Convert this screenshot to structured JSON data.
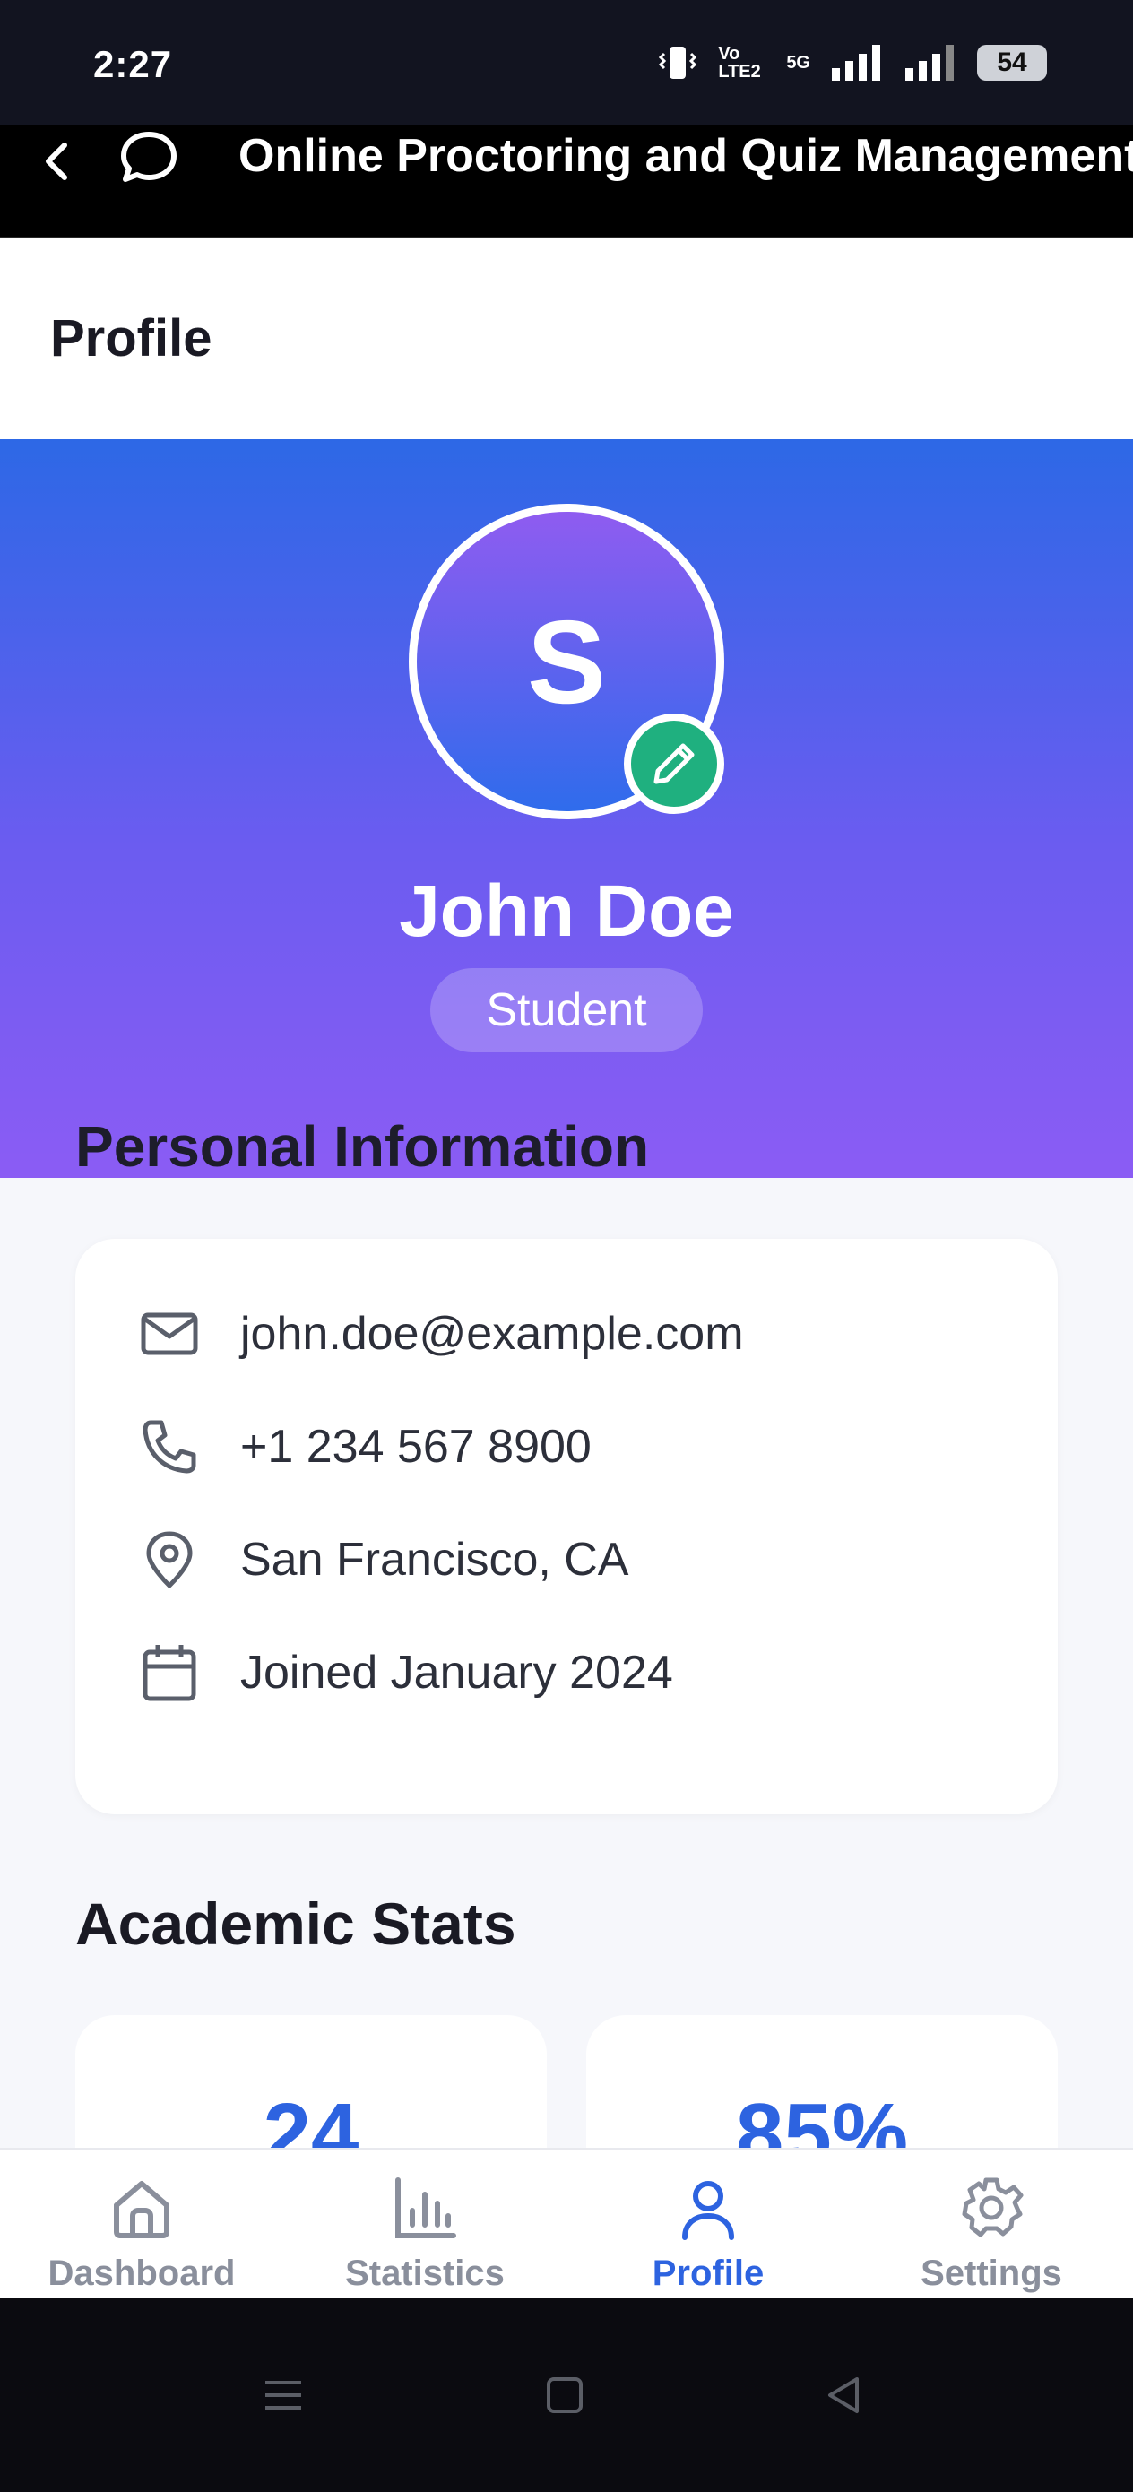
{
  "status_bar": {
    "time": "2:27",
    "network_label": "Vo LTE2",
    "network_5g": "5G",
    "battery": "54"
  },
  "app_bar": {
    "title": "Online Proctoring and Quiz Management"
  },
  "page": {
    "title": "Profile"
  },
  "profile": {
    "avatar_initial": "S",
    "name": "John Doe",
    "role": "Student"
  },
  "personal_information": {
    "section_title": "Personal Information",
    "email": "john.doe@example.com",
    "phone": "+1 234 567 8900",
    "location": "San Francisco, CA",
    "joined": "Joined January 2024"
  },
  "academic_stats": {
    "section_title": "Academic Stats",
    "stat_1_value": "24",
    "stat_2_value": "85%"
  },
  "bottom_nav": {
    "items": [
      {
        "label": "Dashboard",
        "icon": "home-icon"
      },
      {
        "label": "Statistics",
        "icon": "bar-chart-icon"
      },
      {
        "label": "Profile",
        "icon": "user-icon"
      },
      {
        "label": "Settings",
        "icon": "gear-icon"
      }
    ],
    "active": "Profile"
  },
  "colors": {
    "accent": "#2d63e0",
    "gradient_top": "#2d68e6",
    "gradient_bottom": "#8b5cf4",
    "edit_badge": "#1fb07f"
  }
}
